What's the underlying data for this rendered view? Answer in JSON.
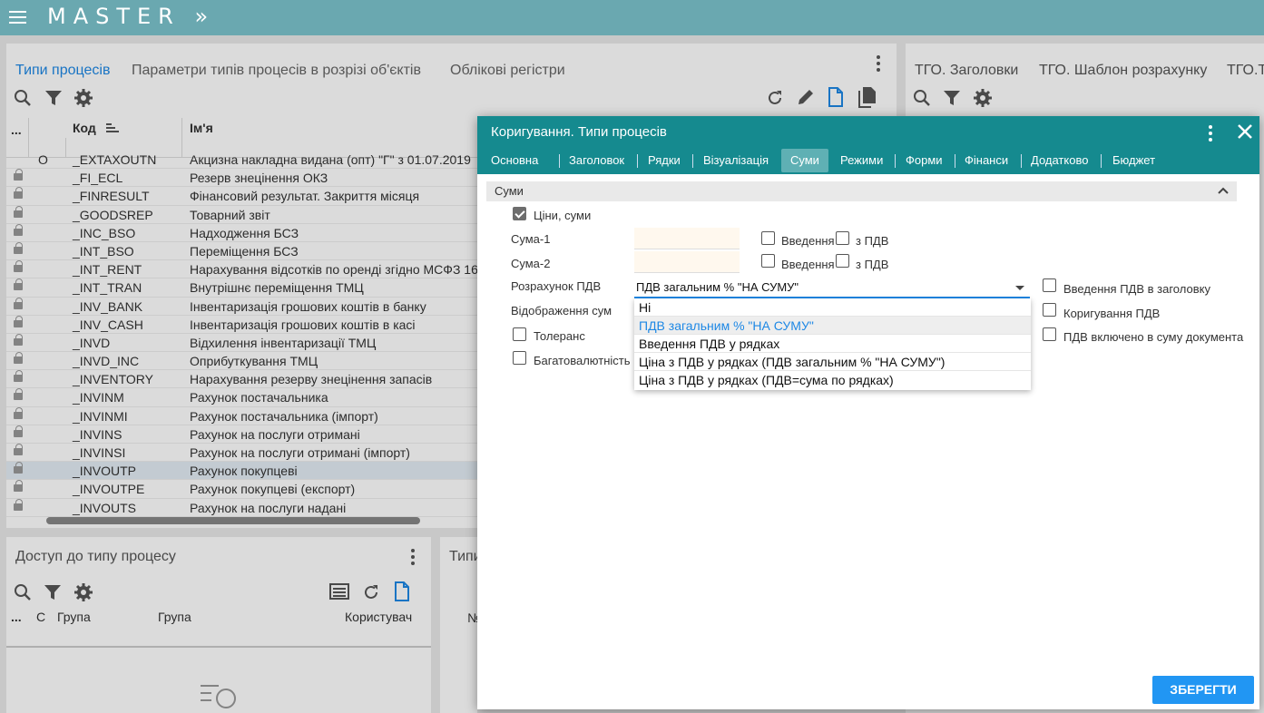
{
  "app": {
    "brand": "MASTER",
    "brand_arrows": "»"
  },
  "left_panel": {
    "tabs": [
      "Типи процесів",
      "Параметри типів процесів в розрізі об'єктів",
      "Облікові регістри"
    ],
    "columns": {
      "sel": "...",
      "code": "Код",
      "name": "Ім'я"
    },
    "rows": [
      {
        "flag": "O",
        "code": "_EXTAXOUTN",
        "name": "Акцизна накладна видана (опт) \"Г\" з 01.07.2019"
      },
      {
        "code": "_FI_ECL",
        "name": "Резерв знецінення ОКЗ"
      },
      {
        "code": "_FINRESULT",
        "name": "Фінансовий результат. Закриття місяця"
      },
      {
        "code": "_GOODSREP",
        "name": "Товарний звіт"
      },
      {
        "code": "_INC_BSO",
        "name": "Надходження БСЗ"
      },
      {
        "code": "_INT_BSO",
        "name": "Переміщення БСЗ"
      },
      {
        "code": "_INT_RENT",
        "name": "Нарахування відсотків по оренді згідно МСФЗ 16"
      },
      {
        "code": "_INT_TRAN",
        "name": "Внутрішнє переміщення ТМЦ"
      },
      {
        "code": "_INV_BANK",
        "name": "Інвентаризація грошових коштів в банку"
      },
      {
        "code": "_INV_CASH",
        "name": "Інвентаризація грошових коштів в касі"
      },
      {
        "code": "_INVD",
        "name": "Відхилення інвентаризації ТМЦ"
      },
      {
        "code": "_INVD_INC",
        "name": "Оприбуткування ТМЦ"
      },
      {
        "code": "_INVENTORY",
        "name": "Нарахування резерву знецінення запасів"
      },
      {
        "code": "_INVINM",
        "name": "Рахунок постачальника"
      },
      {
        "code": "_INVINMI",
        "name": "Рахунок постачальника (імпорт)"
      },
      {
        "code": "_INVINS",
        "name": "Рахунок на послуги отримані"
      },
      {
        "code": "_INVINSI",
        "name": "Рахунок на послуги отримані (імпорт)"
      },
      {
        "code": "_INVOUTP",
        "name": "Рахунок покупцеві",
        "selected": true
      },
      {
        "code": "_INVOUTPE",
        "name": "Рахунок покупцеві (експорт)"
      },
      {
        "code": "_INVOUTS",
        "name": "Рахунок на послуги надані"
      }
    ]
  },
  "right_panel": {
    "tabs": [
      "ТГО. Заголовки",
      "ТГО. Шаблон розрахунку",
      "ТГО.Т"
    ]
  },
  "access_panel": {
    "title": "Доступ до типу процесу",
    "columns": {
      "sel": "...",
      "c": "С",
      "group1": "Група",
      "group2": "Група",
      "user": "Користувач"
    }
  },
  "types_panel": {
    "title": "Типи",
    "column_no": "№"
  },
  "dialog": {
    "title": "Коригування. Типи процесів",
    "tabs": [
      "Основна",
      "Заголовок",
      "Рядки",
      "Візуалізація",
      "Суми",
      "Режими",
      "Форми",
      "Фінанси",
      "Додатково",
      "Бюджет"
    ],
    "active_tab": "Суми",
    "section": "Суми",
    "prices_label": "Ціни, суми",
    "prices_checked": true,
    "sum1_label": "Сума-1",
    "sum2_label": "Сума-2",
    "entry_label": "Введення",
    "with_vat_label": "з ПДВ",
    "vat_calc_label": "Розрахунок ПДВ",
    "vat_calc_value": "ПДВ загальним % \"НА СУМУ\"",
    "display_sums_label": "Відображення сум",
    "tolerance_label": "Толеранс",
    "multicurrency_label": "Багатовалютність",
    "vat_header_label": "Введення ПДВ в заголовку",
    "vat_correction_label": "Коригування ПДВ",
    "vat_included_label": "ПДВ включено в суму документа",
    "options": [
      "Ні",
      "ПДВ загальним % \"НА СУМУ\"",
      "Введення ПДВ у рядках",
      "Ціна з ПДВ у рядках (ПДВ загальним % \"НА СУМУ\")",
      "Ціна з ПДВ у рядках (ПДВ=сума по рядках)"
    ],
    "highlighted_option": 1,
    "save_label": "ЗБЕРЕГТИ"
  },
  "colors": {
    "topbar": "#6aa8b0",
    "dialog_header": "#158a8f",
    "accent": "#1e88e5",
    "save": "#2196f3"
  }
}
